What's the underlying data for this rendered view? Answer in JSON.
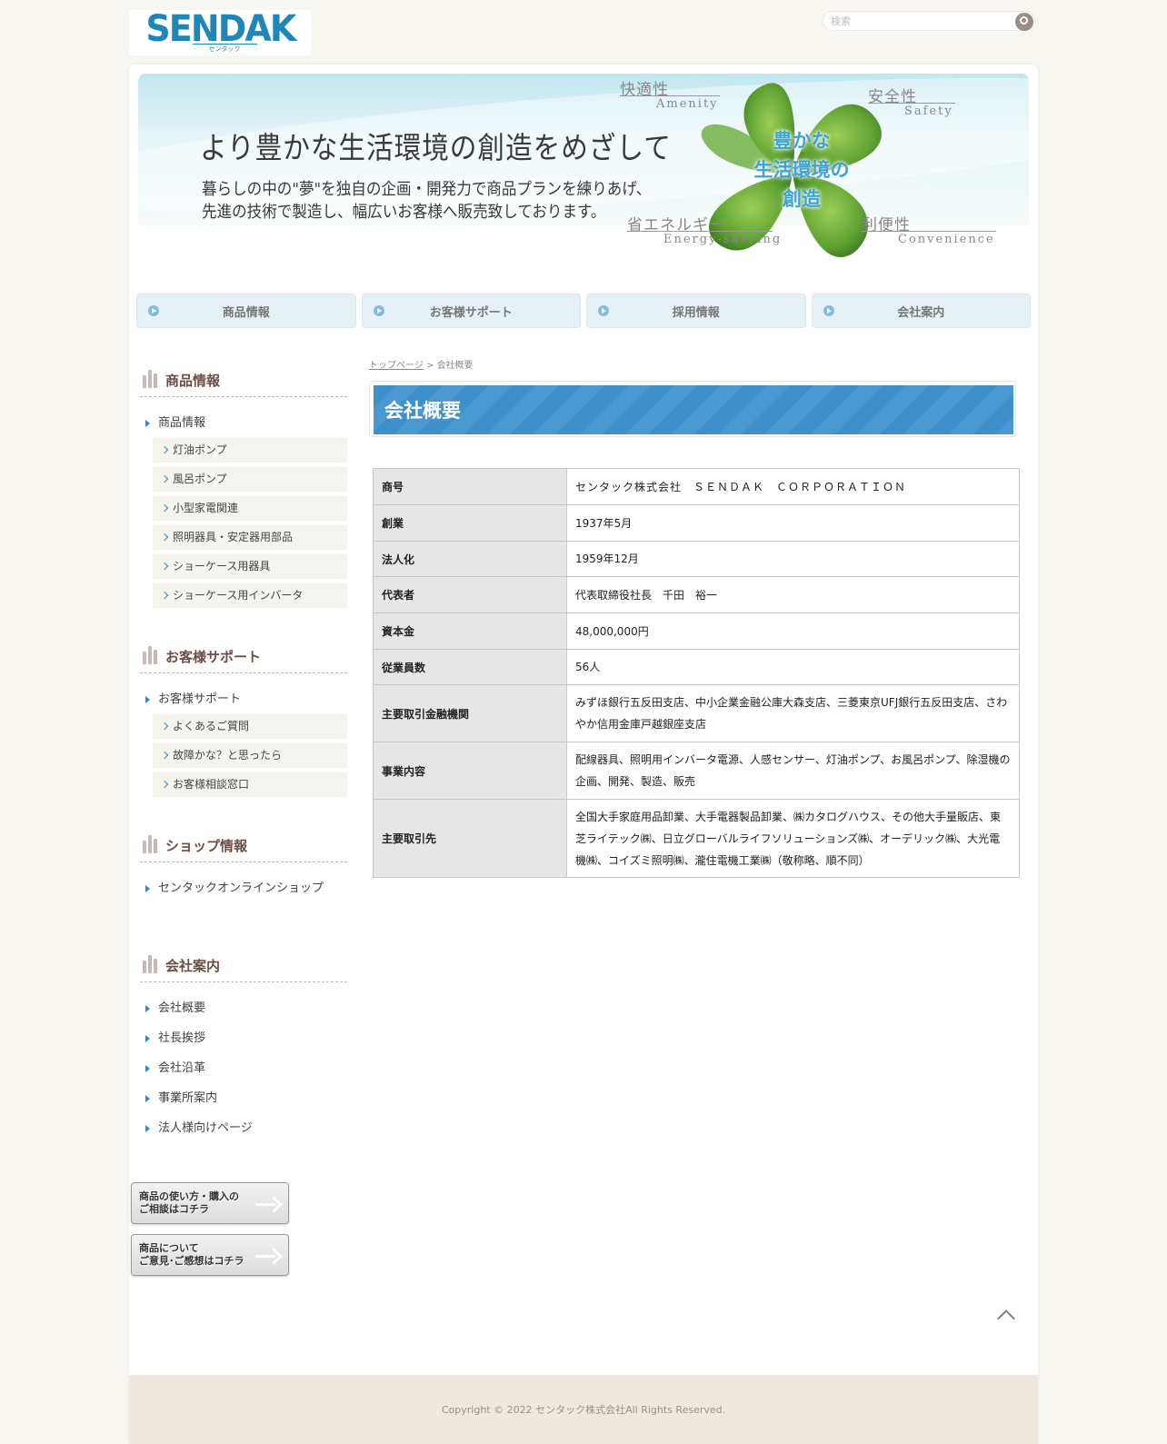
{
  "header": {
    "logo_text": "SENDAK",
    "logo_sub": "センタック",
    "search_placeholder": "検索"
  },
  "banner": {
    "headline": "より豊かな生活環境の創造をめざして",
    "lead_line1": "暮らしの中の\"夢\"を独自の企画・開発力で商品プランを練りあげ、",
    "lead_line2": "先進の技術で製造し、幅広いお客様へ販売致しております。",
    "center_line1": "豊かな",
    "center_line2": "生活環境の",
    "center_line3": "創造",
    "kw1_jp": "快適性",
    "kw1_en": "Amenity",
    "kw2_jp": "安全性",
    "kw2_en": "Safety",
    "kw3_jp": "省エネルギー",
    "kw3_en": "Energy-saveing",
    "kw4_jp": "利便性",
    "kw4_en": "Convenience"
  },
  "gnav": [
    "商品情報",
    "お客様サポート",
    "採用情報",
    "会社案内"
  ],
  "sidebar": {
    "products": {
      "heading": "商品情報",
      "top": "商品情報",
      "items": [
        "灯油ポンプ",
        "風呂ポンプ",
        "小型家電関連",
        "照明器具・安定器用部品",
        "ショーケース用器具",
        "ショーケース用インバータ"
      ]
    },
    "support": {
      "heading": "お客様サポート",
      "top": "お客様サポート",
      "items": [
        "よくあるご質問",
        "故障かな？と思ったら",
        "お客様相談窓口"
      ]
    },
    "shop": {
      "heading": "ショップ情報",
      "top": "センタックオンラインショップ"
    },
    "company": {
      "heading": "会社案内",
      "items": [
        "会社概要",
        "社長挨拶",
        "会社沿革",
        "事業所案内",
        "法人様向けページ"
      ]
    },
    "btn1_line1": "商品の使い方・購入の",
    "btn1_line2": "ご相談はコチラ",
    "btn2_line1": "商品について",
    "btn2_line2": "ご意見･ご感想はコチラ"
  },
  "content": {
    "breadcrumb_home": "トップページ",
    "breadcrumb_sep": " > ",
    "breadcrumb_current": "会社概要",
    "title": "会社概要",
    "table": [
      {
        "label": "商号",
        "value": "センタック株式会社　ＳＥＮＤＡＫ　ＣＯＲＰＯＲＡＴＩＯＮ"
      },
      {
        "label": "創業",
        "value": "1937年5月"
      },
      {
        "label": "法人化",
        "value": "1959年12月"
      },
      {
        "label": "代表者",
        "value": "代表取締役社長　千田　裕一"
      },
      {
        "label": "資本金",
        "value": "48,000,000円"
      },
      {
        "label": "従業員数",
        "value": "56人"
      },
      {
        "label": "主要取引金融機関",
        "value": "みずほ銀行五反田支店、中小企業金融公庫大森支店、三菱東京UFJ銀行五反田支店、さわやか信用金庫戸越銀座支店"
      },
      {
        "label": "事業内容",
        "value": "配線器具、照明用インバータ電源、人感センサー、灯油ポンプ、お風呂ポンプ、除湿機の企画、開発、製造、販売"
      },
      {
        "label": "主要取引先",
        "value": "全国大手家庭用品卸業、大手電器製品卸業、㈱カタログハウス、その他大手量販店、東芝ライテック㈱、日立グローバルライフソリューションズ㈱、オーデリック㈱、大光電機㈱、コイズミ照明㈱、瀧住電機工業㈱（敬称略、順不同）"
      }
    ]
  },
  "footer": {
    "copyright": "Copyright © 2022 センタック株式会社All Rights Reserved."
  }
}
